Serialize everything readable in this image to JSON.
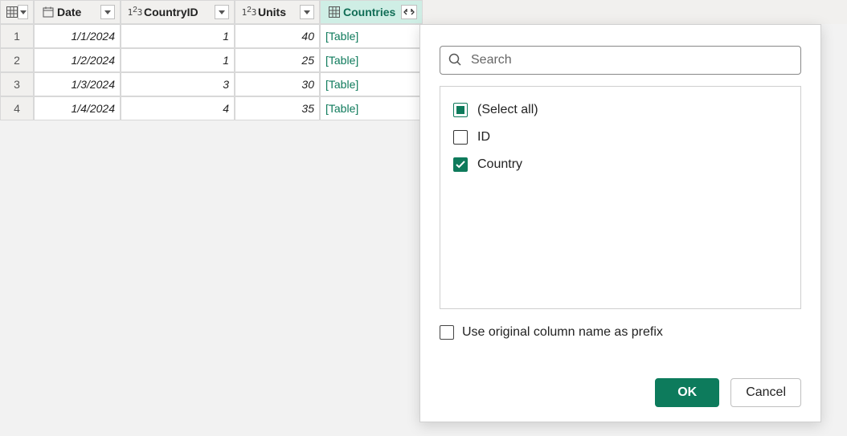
{
  "columns": {
    "date": "Date",
    "countryId": "CountryID",
    "units": "Units",
    "countries": "Countries"
  },
  "rows": [
    {
      "n": "1",
      "date": "1/1/2024",
      "cid": "1",
      "units": "40",
      "ctry": "[Table]"
    },
    {
      "n": "2",
      "date": "1/2/2024",
      "cid": "1",
      "units": "25",
      "ctry": "[Table]"
    },
    {
      "n": "3",
      "date": "1/3/2024",
      "cid": "3",
      "units": "30",
      "ctry": "[Table]"
    },
    {
      "n": "4",
      "date": "1/4/2024",
      "cid": "4",
      "units": "35",
      "ctry": "[Table]"
    }
  ],
  "panel": {
    "searchPlaceholder": "Search",
    "options": {
      "selectAll": "(Select all)",
      "id": "ID",
      "country": "Country"
    },
    "prefixLabel": "Use original column name as prefix",
    "ok": "OK",
    "cancel": "Cancel"
  }
}
